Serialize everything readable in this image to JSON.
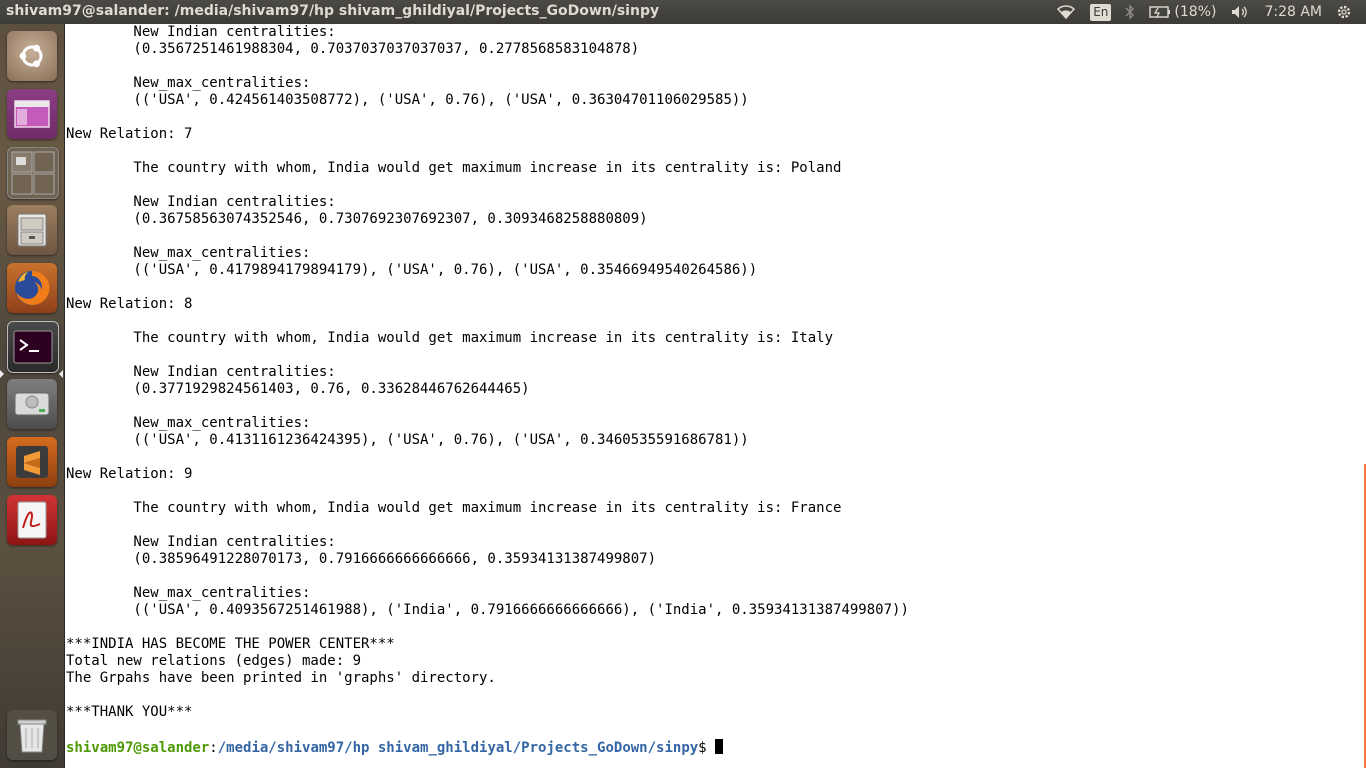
{
  "top_panel": {
    "title": "shivam97@salander: /media/shivam97/hp shivam_ghildiyal/Projects_GoDown/sinpy",
    "keyboard_layout": "En",
    "battery_text": "(18%)",
    "time": "7:28 AM"
  },
  "launcher": {
    "items": [
      "ubuntu-dash",
      "unity-tweak",
      "workspace-switcher",
      "files",
      "firefox",
      "terminal",
      "disk",
      "sublime-text",
      "document-viewer",
      "trash"
    ]
  },
  "terminal": {
    "lines": [
      "        New Indian centralities:",
      "        (0.3567251461988304, 0.7037037037037037, 0.2778568583104878)",
      "",
      "        New_max_centralities:",
      "        (('USA', 0.424561403508772), ('USA', 0.76), ('USA', 0.36304701106029585))",
      "",
      "New Relation: 7",
      "",
      "        The country with whom, India would get maximum increase in its centrality is: Poland",
      "",
      "        New Indian centralities:",
      "        (0.36758563074352546, 0.7307692307692307, 0.3093468258880809)",
      "",
      "        New_max_centralities:",
      "        (('USA', 0.4179894179894179), ('USA', 0.76), ('USA', 0.35466949540264586))",
      "",
      "New Relation: 8",
      "",
      "        The country with whom, India would get maximum increase in its centrality is: Italy",
      "",
      "        New Indian centralities:",
      "        (0.3771929824561403, 0.76, 0.33628446762644465)",
      "",
      "        New_max_centralities:",
      "        (('USA', 0.4131161236424395), ('USA', 0.76), ('USA', 0.3460535591686781))",
      "",
      "New Relation: 9",
      "",
      "        The country with whom, India would get maximum increase in its centrality is: France",
      "",
      "        New Indian centralities:",
      "        (0.38596491228070173, 0.7916666666666666, 0.35934131387499807)",
      "",
      "        New_max_centralities:",
      "        (('USA', 0.4093567251461988), ('India', 0.7916666666666666), ('India', 0.35934131387499807))",
      "",
      "***INDIA HAS BECOME THE POWER CENTER***",
      "Total new relations (edges) made: 9",
      "The Grpahs have been printed in 'graphs' directory.",
      "",
      "***THANK YOU***",
      ""
    ],
    "prompt": {
      "user_host": "shivam97@salander",
      "separator": ":",
      "path": "/media/shivam97/hp shivam_ghildiyal/Projects_GoDown/sinpy",
      "symbol": "$"
    }
  },
  "colors": {
    "prompt_user": "#4e9a06",
    "prompt_path": "#3465a4",
    "panel_bg": "#3c3b37"
  }
}
